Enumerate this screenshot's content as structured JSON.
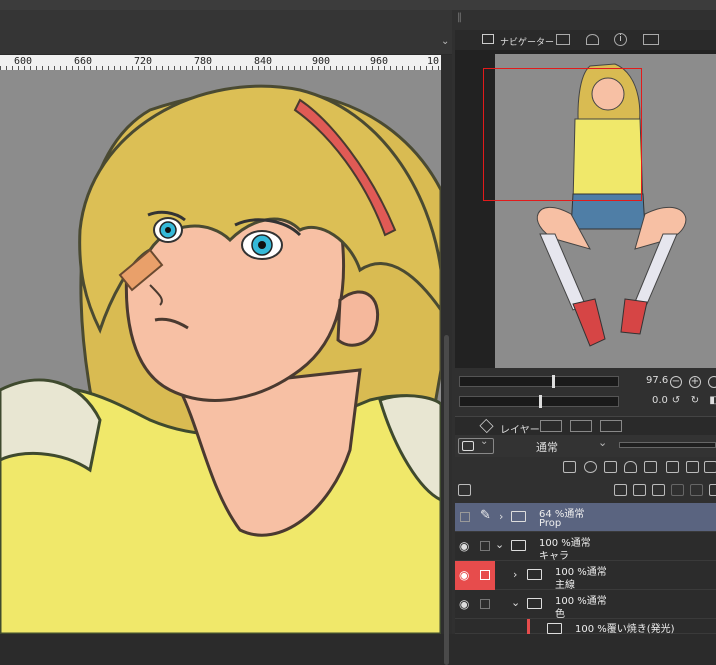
{
  "ruler": {
    "labels": [
      "600",
      "660",
      "720",
      "780",
      "840",
      "900",
      "960",
      "10"
    ]
  },
  "navigator": {
    "tabs": [
      {
        "label": "ナビゲーター"
      }
    ],
    "zoom_value": "97.6",
    "rotate_value": "0.0"
  },
  "layer_panel": {
    "tab_label": "レイヤー",
    "blend_mode": "通常",
    "layers": [
      {
        "percent": "64 %通常",
        "name": "Prop"
      },
      {
        "percent": "100 %通常",
        "name": "キャラ"
      },
      {
        "percent": "100 %通常",
        "name": "主線"
      },
      {
        "percent": "100 %通常",
        "name": "色"
      },
      {
        "percent": "100 %覆い焼き(発光)",
        "name": ""
      }
    ]
  },
  "colors": {
    "accent_red": "#e74c4c",
    "selected_layer": "#5a6480",
    "canvas_bg": "#8c8c8c",
    "hair": "#dcbf55",
    "shirt": "#f0e86a",
    "skin": "#f7c0a4"
  }
}
